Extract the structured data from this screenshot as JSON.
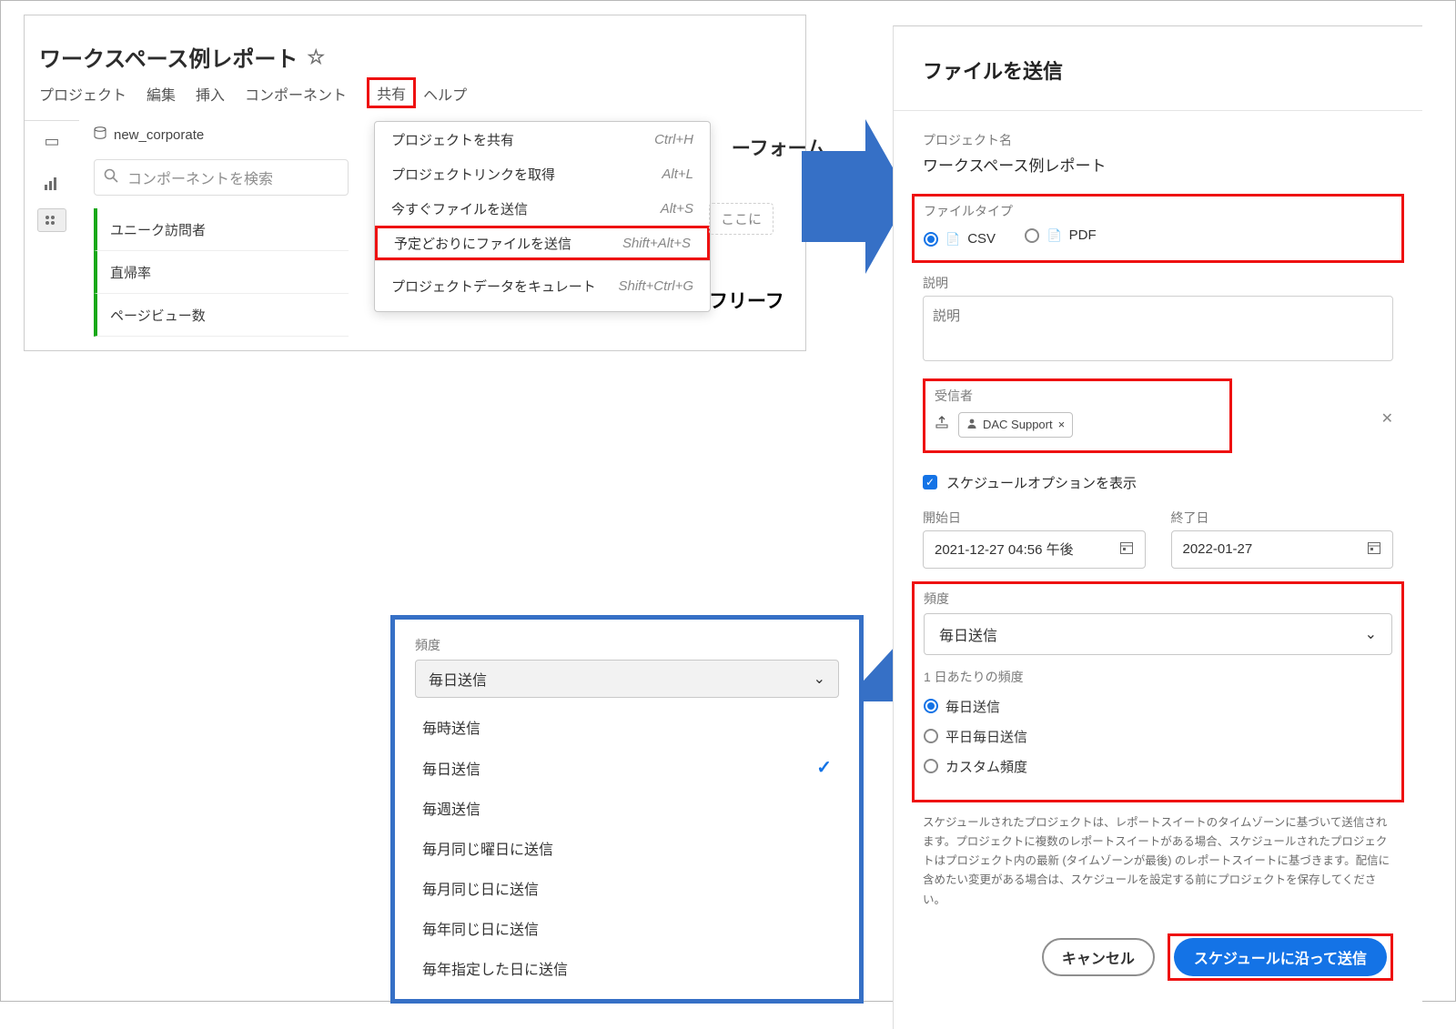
{
  "workspace": {
    "title": "ワークスペース例レポート",
    "menu": [
      "プロジェクト",
      "編集",
      "挿入",
      "コンポーネント",
      "共有",
      "ヘルプ"
    ],
    "reportsuite": "new_corporate",
    "search_placeholder": "コンポーネントを検索",
    "metrics": [
      "ユニーク訪問者",
      "直帰率",
      "ページビュー数"
    ],
    "panel_name_suffix": "ーフォーム",
    "dropzone": "ここに",
    "ff_label": "フリーフ"
  },
  "sharemenu": {
    "items": [
      {
        "label": "プロジェクトを共有",
        "sc": "Ctrl+H"
      },
      {
        "label": "プロジェクトリンクを取得",
        "sc": "Alt+L"
      },
      {
        "label": "今すぐファイルを送信",
        "sc": "Alt+S"
      },
      {
        "label": "予定どおりにファイルを送信",
        "sc": "Shift+Alt+S"
      },
      {
        "label": "プロジェクトデータをキュレート",
        "sc": "Shift+Ctrl+G"
      }
    ]
  },
  "panel": {
    "title": "ファイルを送信",
    "proj_label": "プロジェクト名",
    "proj_name": "ワークスペース例レポート",
    "ftype_label": "ファイルタイプ",
    "ftype_csv": "CSV",
    "ftype_pdf": "PDF",
    "desc_label": "説明",
    "desc_placeholder": "説明",
    "rec_label": "受信者",
    "rec_value": "DAC Support",
    "sched_cb": "スケジュールオプションを表示",
    "start_label": "開始日",
    "start_value": "2021-12-27 04:56 午後",
    "end_label": "終了日",
    "end_value": "2022-01-27",
    "freq_label": "頻度",
    "freq_value": "毎日送信",
    "daily_label": "1 日あたりの頻度",
    "daily_opts": [
      "毎日送信",
      "平日毎日送信",
      "カスタム頻度"
    ],
    "note": "スケジュールされたプロジェクトは、レポートスイートのタイムゾーンに基づいて送信されます。プロジェクトに複数のレポートスイートがある場合、スケジュールされたプロジェクトはプロジェクト内の最新 (タイムゾーンが最後) のレポートスイートに基づきます。配信に含めたい変更がある場合は、スケジュールを設定する前にプロジェクトを保存してください。",
    "cancel": "キャンセル",
    "send": "スケジュールに沿って送信"
  },
  "freqpop": {
    "label": "頻度",
    "selected": "毎日送信",
    "opts": [
      "毎時送信",
      "毎日送信",
      "毎週送信",
      "毎月同じ曜日に送信",
      "毎月同じ日に送信",
      "毎年同じ日に送信",
      "毎年指定した日に送信"
    ]
  }
}
